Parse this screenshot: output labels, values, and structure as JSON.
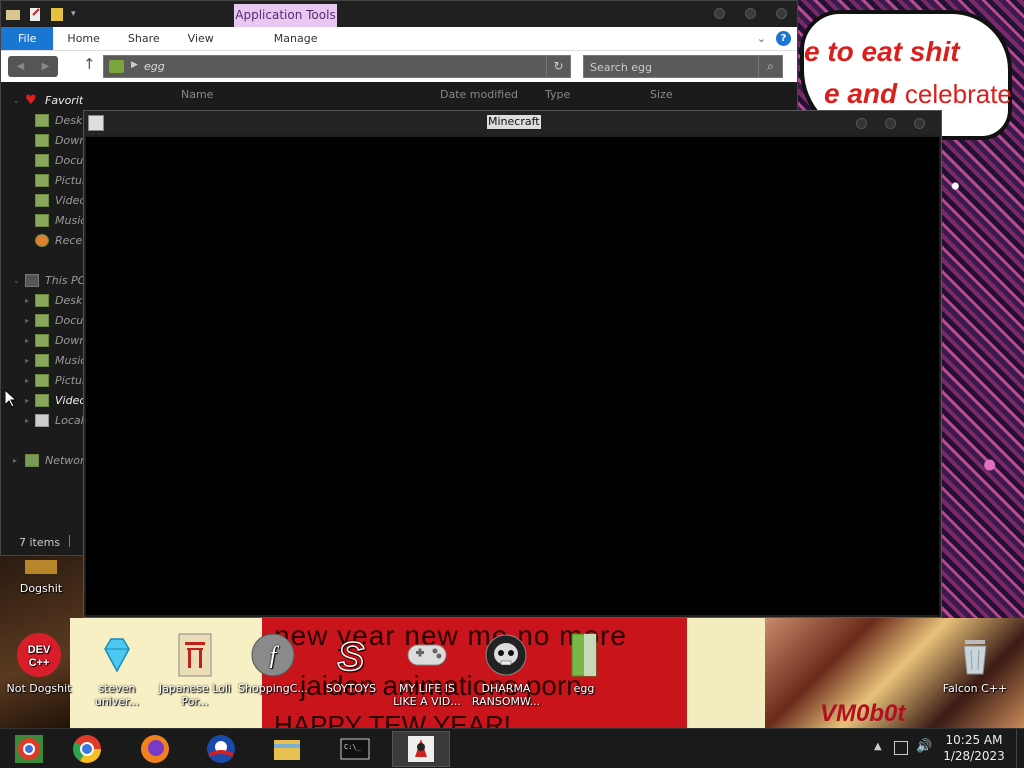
{
  "wallpaper": {
    "speech_line1": "e to eat shit",
    "speech_line2_a": "e and",
    "speech_line2_b": "celebrate",
    "banner_line1": "new year new me no more",
    "banner_line2": "jaiden animations porn.",
    "banner_line3": "HAPPY TEW YEAR!",
    "watermark": "VM0b0t"
  },
  "explorer": {
    "app_tools_tab": "Application Tools",
    "ribbon": {
      "file": "File",
      "home": "Home",
      "share": "Share",
      "view": "View",
      "manage": "Manage"
    },
    "help_icon": "?",
    "path": "egg",
    "search_placeholder": "Search egg",
    "columns": [
      "Name",
      "Date modified",
      "Type",
      "Size"
    ],
    "nav": {
      "favorites": "Favorites",
      "fav_items": [
        "Desktop",
        "Downloads",
        "Documents",
        "Pictures",
        "Videos",
        "Music",
        "Recent places"
      ],
      "this_pc": "This PC",
      "pc_items": [
        "Desktop",
        "Documents",
        "Downloads",
        "Music",
        "Pictures",
        "Videos",
        "Local Disk"
      ],
      "network": "Network"
    },
    "status": "7 items"
  },
  "minecraft": {
    "title": "Minecraft"
  },
  "desktop_icons": [
    {
      "label": "Dogshit",
      "icon": "folder-icon"
    },
    {
      "label": "Not Dogshit",
      "icon": "devcpp-icon"
    },
    {
      "label": "steven univer...",
      "icon": "diamond-icon"
    },
    {
      "label": "Japanese Loli Por...",
      "icon": "torii-icon"
    },
    {
      "label": "ShoppingC...",
      "icon": "flash-icon"
    },
    {
      "label": "SOYTOYS",
      "icon": "s-logo-icon"
    },
    {
      "label": "MY LIFE IS LIKE A VID...",
      "icon": "gamepad-icon"
    },
    {
      "label": "DHARMA RANSOMW...",
      "icon": "skull-icon"
    },
    {
      "label": "egg",
      "icon": "green-file-icon"
    },
    {
      "label": "Falcon C++",
      "icon": "trash-icon"
    }
  ],
  "taskbar": {
    "items": [
      "chrome-alt-icon",
      "chrome-icon",
      "firefox-icon",
      "obama-icon",
      "explorer-icon",
      "cmd-icon",
      "java-icon"
    ],
    "time": "10:25 AM",
    "date": "1/28/2023"
  },
  "colors": {
    "accent": "#1976d2",
    "app_tools_bg": "#e8c8f0",
    "window_bg": "#1d1d1d"
  }
}
